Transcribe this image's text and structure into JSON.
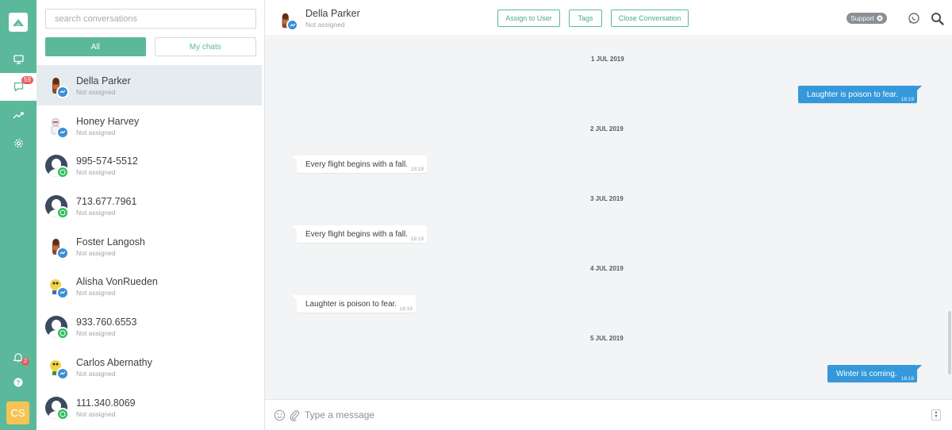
{
  "colors": {
    "brand": "#5cb89b",
    "outgoing_bubble": "#3498db",
    "badge": "#e55e5e",
    "messenger": "#3b8fd6",
    "whatsapp": "#2fbd5c",
    "user_avatar": "#f6c453"
  },
  "sidebar": {
    "items": [
      {
        "icon": "logo-icon"
      },
      {
        "icon": "monitor-icon"
      },
      {
        "icon": "chat-icon",
        "badge": "59"
      },
      {
        "icon": "trending-icon"
      },
      {
        "icon": "settings-icon"
      }
    ],
    "notifications_badge": "2",
    "user_initials": "CS"
  },
  "conversations": {
    "search_placeholder": "search conversations",
    "filter_all": "All",
    "filter_mine": "My chats",
    "items": [
      {
        "name": "Della Parker",
        "status": "Not assigned",
        "channel": "messenger",
        "active": true
      },
      {
        "name": "Honey Harvey",
        "status": "Not assigned",
        "channel": "messenger"
      },
      {
        "name": "995-574-5512",
        "status": "Not assigned",
        "channel": "whatsapp"
      },
      {
        "name": "713.677.7961",
        "status": "Not assigned",
        "channel": "whatsapp"
      },
      {
        "name": "Foster Langosh",
        "status": "Not assigned",
        "channel": "messenger"
      },
      {
        "name": "Alisha VonRueden",
        "status": "Not assigned",
        "channel": "messenger"
      },
      {
        "name": "933.760.6553",
        "status": "Not assigned",
        "channel": "whatsapp"
      },
      {
        "name": "Carlos Abernathy",
        "status": "Not assigned",
        "channel": "messenger"
      },
      {
        "name": "111.340.8069",
        "status": "Not assigned",
        "channel": "whatsapp"
      }
    ]
  },
  "header": {
    "name": "Della Parker",
    "status": "Not assigned",
    "assign_label": "Assign to User",
    "tags_label": "Tags",
    "close_label": "Close Conversation",
    "support_label": "Support"
  },
  "messages": [
    {
      "date": "1 JUL 2019",
      "text": "Laughter is poison to fear.",
      "time": "18:19",
      "direction": "out"
    },
    {
      "date": "2 JUL 2019",
      "text": "Every flight begins with a fall.",
      "time": "18:19",
      "direction": "in"
    },
    {
      "date": "3 JUL 2019",
      "text": "Every flight begins with a fall.",
      "time": "18:19",
      "direction": "in"
    },
    {
      "date": "4 JUL 2019",
      "text": "Laughter is poison to fear.",
      "time": "18:19",
      "direction": "in"
    },
    {
      "date": "5 JUL 2019",
      "text": "Winter is coming.",
      "time": "18:19",
      "direction": "out"
    }
  ],
  "composer": {
    "placeholder": "Type a message"
  }
}
